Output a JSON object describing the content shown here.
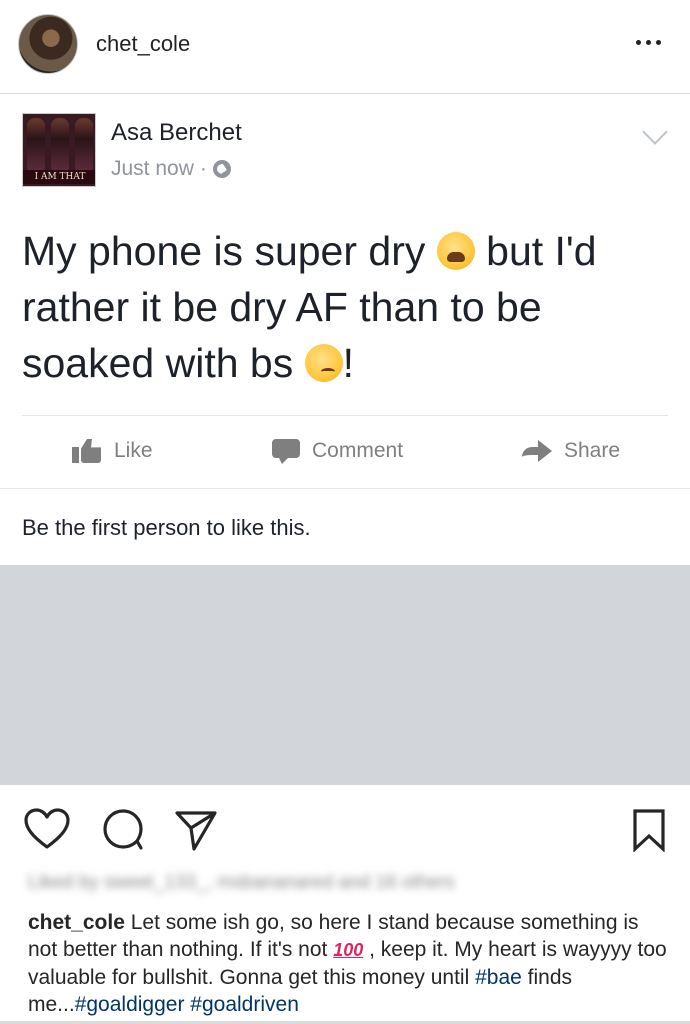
{
  "instagram": {
    "username": "chet_cole",
    "liked_by": "Liked by sweet_133_, msbananared and 16 others",
    "caption": {
      "username": "chet_cole",
      "text_1": " Let some ish go, so here I stand because something is not better than nothing. If it's not ",
      "emoji_100": "100",
      "text_2": " , keep it. My heart is wayyyy too valuable for bullshit. Gonna get this money until ",
      "tag_1": "#bae",
      "text_3": " finds me...",
      "tag_2": "#goaldigger",
      "text_4": " ",
      "tag_3": "#goaldriven"
    }
  },
  "facebook_post": {
    "author_name": "Asa Berchet",
    "avatar_banner": "I AM THAT GIRL",
    "timestamp": "Just now",
    "meta_separator": "·",
    "text_1": "My phone is super dry ",
    "text_2": " but I'd rather it be dry AF than to be soaked with bs ",
    "text_3": "!",
    "actions": {
      "like": "Like",
      "comment": "Comment",
      "share": "Share"
    },
    "likes_summary": "Be the first person to like this."
  },
  "colors": {
    "facebook_action_gray": "#7f7f7f",
    "placeholder_gray": "#d2d5da",
    "hashtag_blue": "#003569"
  }
}
